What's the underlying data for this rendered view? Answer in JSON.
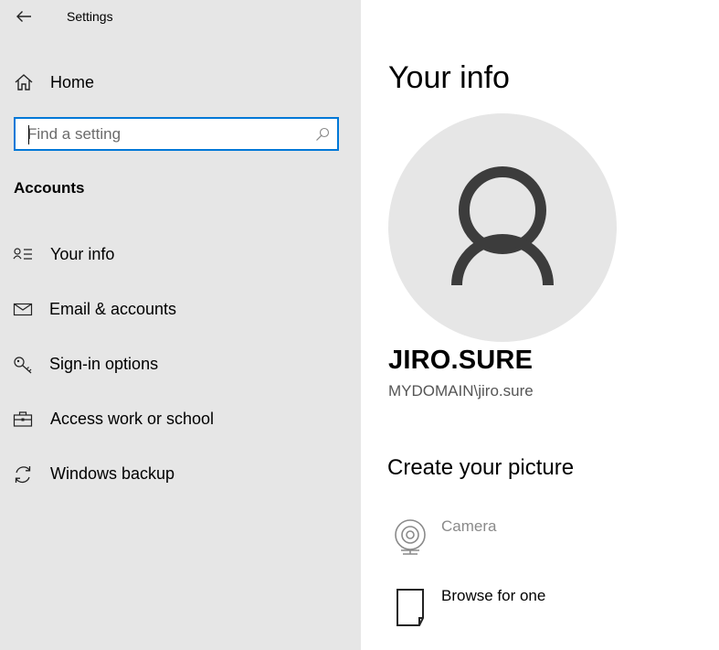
{
  "window": {
    "title": "Settings"
  },
  "sidebar": {
    "home_label": "Home",
    "search": {
      "placeholder": "Find a setting"
    },
    "section_heading": "Accounts",
    "items": [
      {
        "label": "Your info",
        "icon": "your-info-icon",
        "selected": true
      },
      {
        "label": "Email & accounts",
        "icon": "mail-icon"
      },
      {
        "label": "Sign-in options",
        "icon": "key-icon"
      },
      {
        "label": "Access work or school",
        "icon": "briefcase-icon"
      },
      {
        "label": "Windows backup",
        "icon": "sync-icon"
      }
    ]
  },
  "main": {
    "title": "Your info",
    "user": {
      "name": "JIRO.SURE",
      "account": "MYDOMAIN\\jiro.sure"
    },
    "create_picture": {
      "heading": "Create your picture",
      "options": [
        {
          "label": "Camera",
          "icon": "webcam-icon",
          "enabled": false
        },
        {
          "label": "Browse for one",
          "icon": "file-icon",
          "enabled": true
        }
      ]
    }
  },
  "colors": {
    "accent": "#0078d7",
    "sidebar_bg": "#e6e6e6",
    "avatar_bg": "#e6e6e6",
    "avatar_figure": "#3c3c3c",
    "disabled_text": "#8a8a8a"
  }
}
